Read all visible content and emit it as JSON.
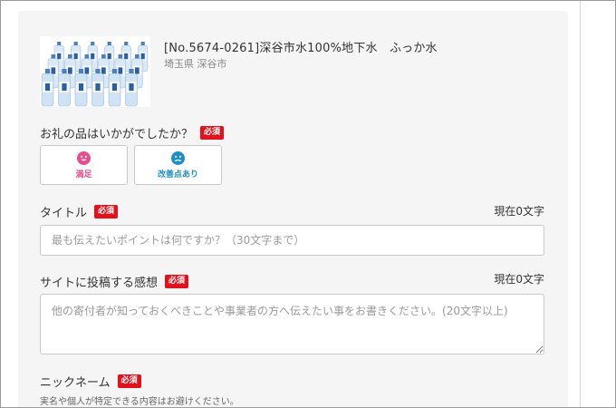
{
  "product": {
    "name": "[No.5674-0261]深谷市水100%地下水　ふっか水",
    "location": "埼玉県 深谷市",
    "image_icon": "water-bottles-image"
  },
  "required_badge": "必須",
  "rating": {
    "question": "お礼の品はいかがでしたか？",
    "options": [
      {
        "label": "満足",
        "icon": "smile-icon",
        "color": "#e64d8c"
      },
      {
        "label": "改善点あり",
        "icon": "improve-icon",
        "color": "#1e8fc4"
      }
    ]
  },
  "title_field": {
    "label": "タイトル",
    "counter": "現在0文字",
    "placeholder": "最も伝えたいポイントは何ですか？（30文字まで）"
  },
  "impression_field": {
    "label": "サイトに投稿する感想",
    "counter": "現在0文字",
    "placeholder": "他の寄付者が知っておくべきことや事業者の方へ伝えたい事をお書きください。(20文字以上)"
  },
  "nickname_field": {
    "label": "ニックネーム",
    "note": "実名や個人が特定できる内容はお避けください。"
  },
  "colors": {
    "required": "#e2121d",
    "card_bg": "#f5f5f5"
  }
}
